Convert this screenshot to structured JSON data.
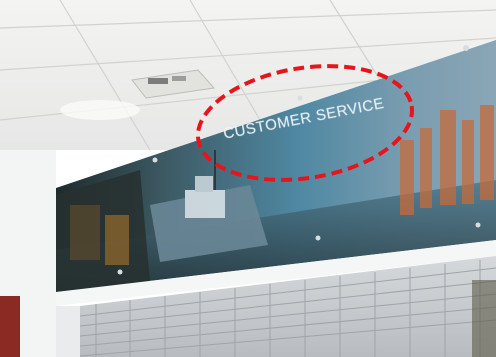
{
  "photo": {
    "sign_text": "CUSTOMER SERVICE",
    "annotation": {
      "type": "ellipse",
      "color": "#e8141c",
      "style": "dashed"
    }
  },
  "colors": {
    "ceiling": "#f1f1ef",
    "wall": "#f6f7f7",
    "mural_sky": "#5b8fa4",
    "mural_dark": "#2f3a3c",
    "shutter": "#c8ccd0",
    "door_frame": "#8a2a22"
  }
}
